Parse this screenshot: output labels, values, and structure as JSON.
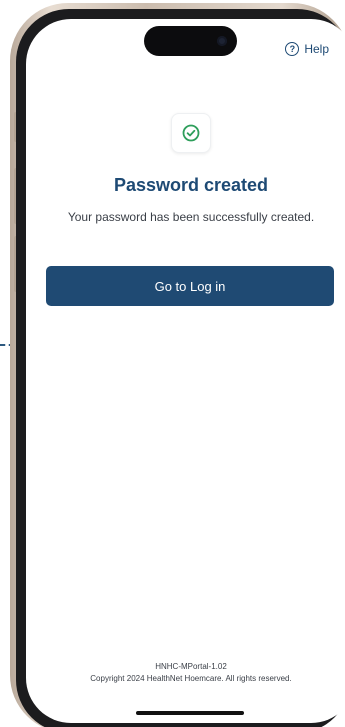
{
  "header": {
    "help_label": "Help",
    "help_icon": "question-circle-icon"
  },
  "status": {
    "icon": "check-circle-icon",
    "icon_color": "#2e9e5b",
    "title": "Password created",
    "message": "Your password has been successfully created."
  },
  "actions": {
    "login_label": "Go to Log in"
  },
  "footer": {
    "version": "HNHC-MPortal-1.02",
    "copyright": "Copyright 2024 HealthNet Hoemcare. All rights reserved."
  },
  "colors": {
    "brand": "#1e4a74",
    "button": "#1f4a73",
    "success": "#2e9e5b"
  }
}
